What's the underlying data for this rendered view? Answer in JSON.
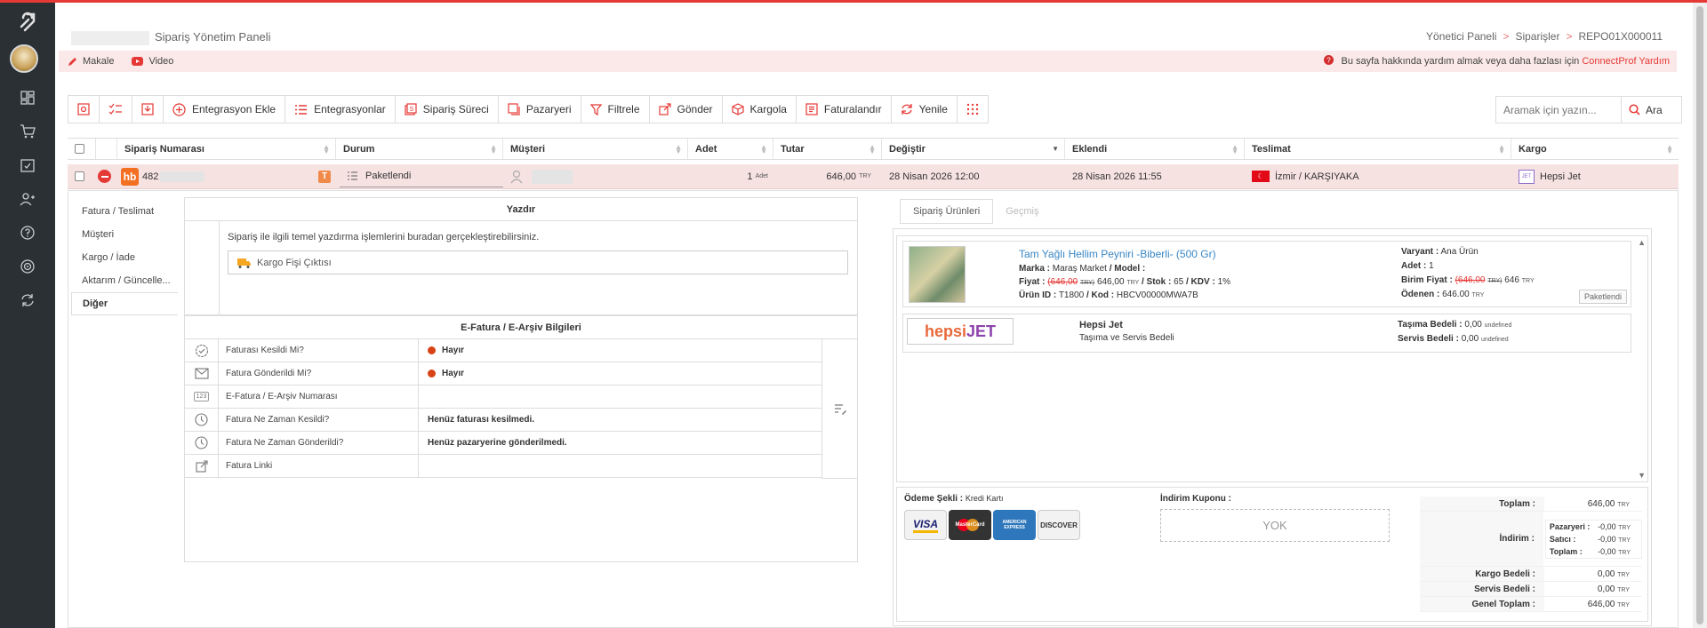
{
  "header": {
    "title": "Sipariş Yönetim Paneli",
    "breadcrumb": [
      "Yönetici Paneli",
      "Siparişler",
      "REPO01X000011"
    ],
    "breadcrumb_sep": ">"
  },
  "helpbar": {
    "links": [
      "Makale",
      "Video"
    ],
    "help_text": "Bu sayfa hakkında yardım almak veya daha fazlası için",
    "help_link": "ConnectProf Yardım"
  },
  "toolbar": {
    "buttons": [
      "Entegrasyon Ekle",
      "Entegrasyonlar",
      "Sipariş Süreci",
      "Pazaryeri",
      "Filtrele",
      "Gönder",
      "Kargola",
      "Faturalandır",
      "Yenile"
    ],
    "search_placeholder": "Aramak için yazın...",
    "search_button": "Ara"
  },
  "grid": {
    "columns": [
      "Sipariş Numarası",
      "Durum",
      "Müşteri",
      "Adet",
      "Tutar",
      "Değiştir",
      "Eklendi",
      "Teslimat",
      "Kargo"
    ],
    "row": {
      "order_no": "482",
      "marketplace_badge": "hb",
      "type_badge": "T",
      "status": "Paketlendi",
      "qty": "1",
      "qty_unit": "Adet",
      "amount": "646,00",
      "currency": "TRY",
      "changed": "28 Nisan 2026 12:00",
      "added": "28 Nisan 2026 11:55",
      "delivery": "İzmir / KARŞIYAKA",
      "cargo_badge": "JET",
      "cargo": "Hepsi Jet"
    }
  },
  "leftmenu": [
    "Fatura / Teslimat",
    "Müşteri",
    "Kargo / İade",
    "Aktarım / Güncelle...",
    "Diğer"
  ],
  "print": {
    "title": "Yazdır",
    "desc": "Sipariş ile ilgili temel yazdırma işlemlerini buradan gerçekleştirebilirsiniz.",
    "button": "Kargo Fişi Çıktısı"
  },
  "einvoice": {
    "title": "E-Fatura / E-Arşiv Bilgileri",
    "rows": [
      {
        "label": "Faturası Kesildi Mi?",
        "value": "Hayır"
      },
      {
        "label": "Fatura Gönderildi Mi?",
        "value": "Hayır"
      },
      {
        "label": "E-Fatura / E-Arşiv Numarası",
        "value": ""
      },
      {
        "label": "Fatura Ne Zaman Kesildi?",
        "value": "Henüz faturası kesilmedi."
      },
      {
        "label": "Fatura Ne Zaman Gönderildi?",
        "value": "Henüz pazaryerine gönderilmedi."
      },
      {
        "label": "Fatura Linki",
        "value": ""
      }
    ],
    "icon_123": "123"
  },
  "tabs": [
    "Sipariş Ürünleri",
    "Geçmiş"
  ],
  "product": {
    "name": "Tam Yağlı Hellim Peyniri -Biberli- (500 Gr)",
    "brand_label": "Marka :",
    "brand": "Maraş Market",
    "model_label": "/ Model :",
    "price_label": "Fiyat :",
    "price_old": "(646,00",
    "price_old_cur": "TRY)",
    "price": "646,00",
    "price_cur": "TRY",
    "stock_label": "/ Stok :",
    "stock": "65",
    "kdv_label": "/ KDV :",
    "kdv": "1%",
    "id_label": "Ürün ID :",
    "id": "T1800",
    "code_label": "/ Kod :",
    "code": "HBCV00000MWA7B",
    "variant_label": "Varyant :",
    "variant": "Ana Ürün",
    "qty_label": "Adet :",
    "qty": "1",
    "unit_label": "Birim Fiyat :",
    "unit_old": "(646,00",
    "unit_old_cur": "TRY)",
    "unit": "646",
    "unit_cur": "TRY",
    "paid_label": "Ödenen :",
    "paid": "646.00",
    "paid_cur": "TRY",
    "status": "Paketlendi"
  },
  "shipping": {
    "logo_a": "hepsi",
    "logo_b": "JET",
    "name": "Hepsi Jet",
    "desc": "Taşıma ve Servis Bedeli",
    "carry_label": "Taşıma Bedeli :",
    "carry": "0,00",
    "carry_unit": "undefined",
    "service_label": "Servis Bedeli :",
    "service": "0,00",
    "service_unit": "undefined"
  },
  "payment": {
    "method_label": "Ödeme Şekli :",
    "method": "Kredi Kartı",
    "cards": [
      "VISA",
      "MasterCard",
      "AMERICAN EXPRESS",
      "DISCOVER"
    ],
    "coupon_label": "İndirim Kuponu :",
    "coupon": "YOK"
  },
  "totals": {
    "toplam_label": "Toplam :",
    "toplam": "646,00",
    "indirim_label": "İndirim :",
    "pazaryeri_label": "Pazaryeri :",
    "pazaryeri": "-0,00",
    "satici_label": "Satıcı :",
    "satici": "-0,00",
    "itoplam_label": "Toplam :",
    "itoplam": "-0,00",
    "kargo_label": "Kargo Bedeli :",
    "kargo": "0,00",
    "servis_label": "Servis Bedeli :",
    "servis": "0,00",
    "genel_label": "Genel Toplam :",
    "genel": "646,00",
    "cur": "TRY"
  }
}
